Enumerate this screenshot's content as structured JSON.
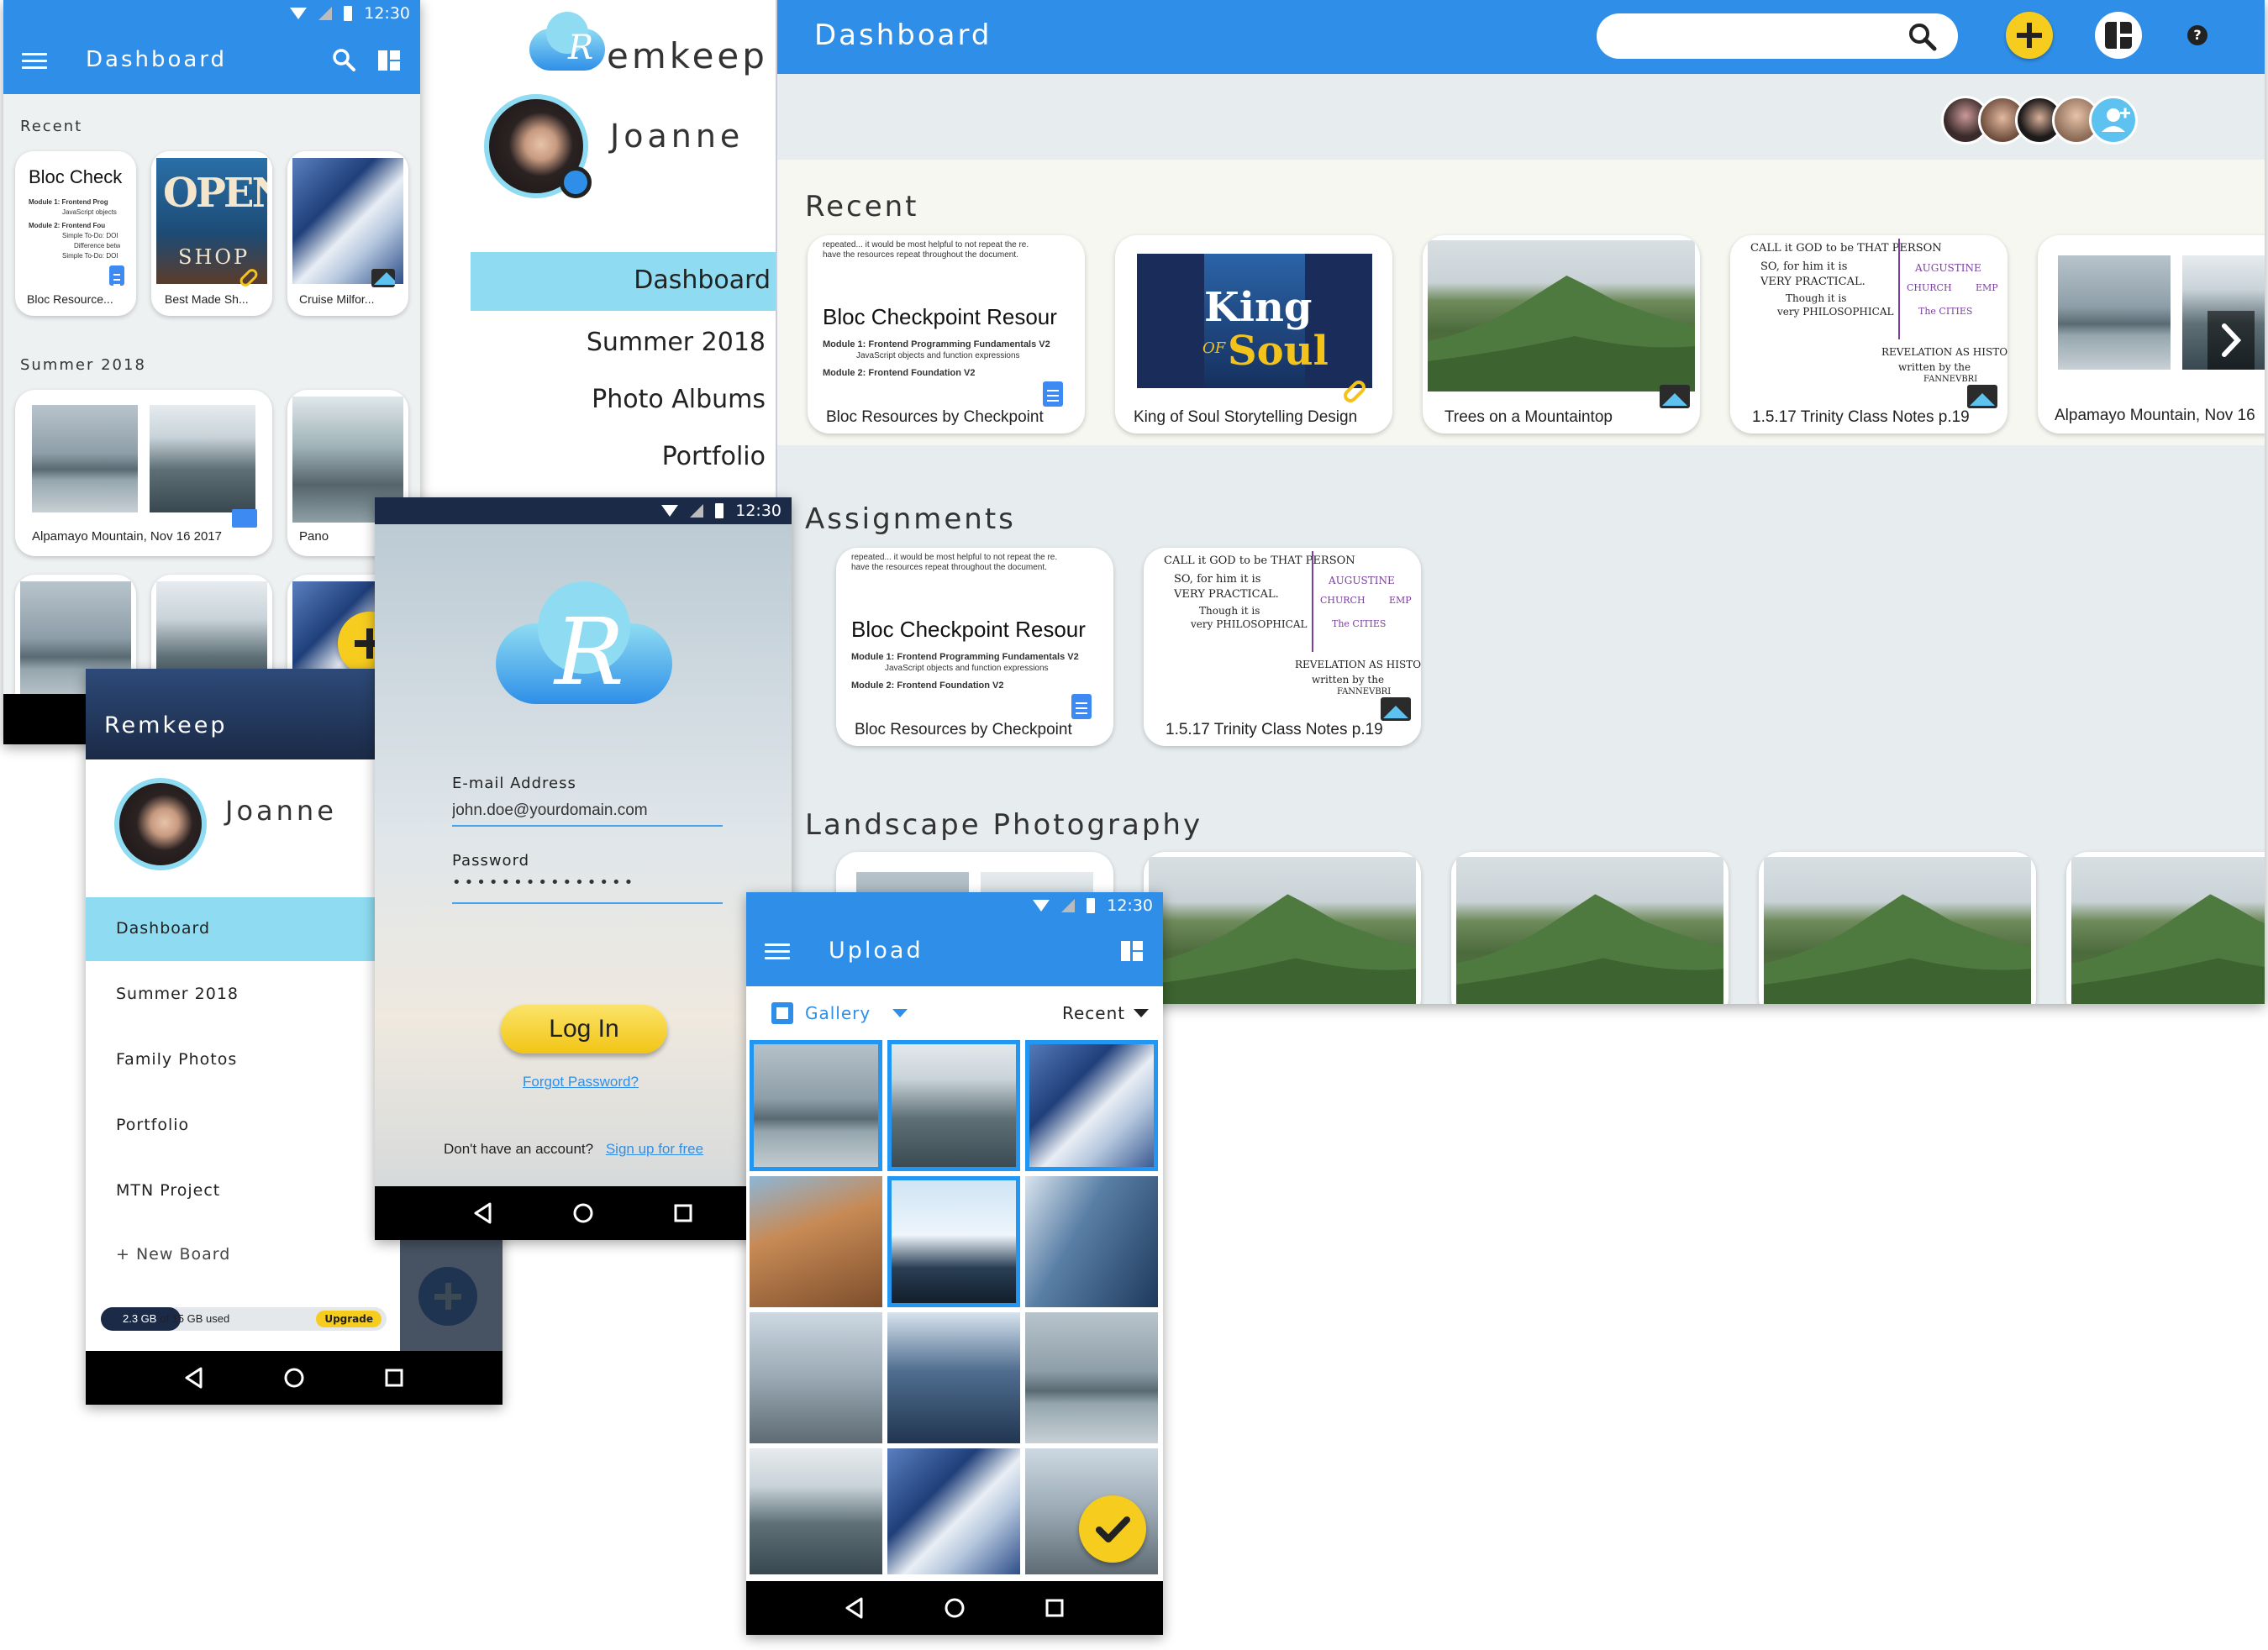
{
  "status_time": "12:30",
  "colors": {
    "primary": "#2f8fe8",
    "accent": "#f6cd1f",
    "highlight": "#8fdcf2",
    "dark": "#1b2a47"
  },
  "phone_dashboard": {
    "title": "Dashboard",
    "recent_heading": "Recent",
    "recent_cards": [
      {
        "doc_title": "Bloc Check",
        "lines": [
          "Module 1: Frontend Prog",
          "JavaScript objects",
          "Module 2: Frontend Fou",
          "Simple To-Do: DOI",
          "Difference betw",
          "Simple To-Do: DOI"
        ],
        "caption": "Bloc Resource..."
      },
      {
        "sign_top": "OPEN",
        "sign_bottom": "SHOP",
        "caption": "Best Made Sh..."
      },
      {
        "caption": "Cruise Milfor..."
      }
    ],
    "summer_heading": "Summer 2018",
    "summer_cards": [
      {
        "caption": "Alpamayo Mountain, Nov 16 2017"
      },
      {
        "caption": "Pano"
      }
    ]
  },
  "tablet_drawer": {
    "logo_text": "emkeep",
    "logo_letter": "R",
    "user_name": "Joanne",
    "items": [
      "Dashboard",
      "Summer 2018",
      "Photo Albums",
      "Portfolio"
    ]
  },
  "desktop": {
    "title": "Dashboard",
    "search": {
      "placeholder": ""
    },
    "sections": {
      "recent": "Recent",
      "assignments": "Assignments",
      "landscape": "Landscape Photography"
    },
    "recent_cards": [
      {
        "snippet1": "repeated... it would be most helpful to not repeat the re.",
        "snippet2": "have the resources repeat throughout the document.",
        "doc_title": "Bloc Checkpoint Resour",
        "m1": "Module 1: Frontend Programming Fundamentals V2",
        "m1sub": "JavaScript objects and function expressions",
        "m2": "Module 2: Frontend Foundation V2",
        "caption": "Bloc Resources by Checkpoint"
      },
      {
        "poster_big": "King",
        "poster_of": "OF",
        "poster_soul": "Soul",
        "caption": "King of Soul Storytelling Design"
      },
      {
        "caption": "Trees on a Mountaintop"
      },
      {
        "notes": [
          "CALL it GOD to be THAT PERSON",
          "SO, for him it is",
          "VERY PRACTICAL.",
          "Though it is",
          "very PHILOSOPHICAL",
          "AUGUSTINE",
          "CHURCH",
          "EMP",
          "The CITIES",
          "REVELATION AS HISTOR",
          "written by the",
          "FANNEVBRI"
        ],
        "caption": "1.5.17 Trinity Class Notes p.19"
      },
      {
        "caption": "Alpamayo Mountain, Nov 16"
      }
    ],
    "assignment_cards": [
      {
        "snippet1": "repeated... it would be most helpful to not repeat the re.",
        "snippet2": "have the resources repeat throughout the document.",
        "doc_title": "Bloc Checkpoint Resour",
        "m1": "Module 1: Frontend Programming Fundamentals V2",
        "m1sub": "JavaScript objects and function expressions",
        "m2": "Module 2: Frontend Foundation V2",
        "caption": "Bloc Resources by Checkpoint"
      },
      {
        "notes": [
          "CALL it GOD to be THAT PERSON",
          "SO, for him it is",
          "VERY PRACTICAL.",
          "Though it is",
          "very PHILOSOPHICAL",
          "AUGUSTINE",
          "CHURCH",
          "EMP",
          "The CITIES",
          "REVELATION AS HISTOR",
          "written by the",
          "FANNEVBRI"
        ],
        "caption": "1.5.17 Trinity Class Notes p.19"
      }
    ]
  },
  "phone_drawer": {
    "app_name": "Remkeep",
    "user_name": "Joanne",
    "items": [
      "Dashboard",
      "Summer 2018",
      "Family Photos",
      "Portfolio",
      "MTN Project",
      "+ New Board"
    ],
    "storage": {
      "used": "2.3 GB",
      "rest": "of 15 GB used",
      "upgrade": "Upgrade",
      "fraction": 0.153
    }
  },
  "login": {
    "logo_letter": "R",
    "email_label": "E-mail Address",
    "email_value": "john.doe@yourdomain.com",
    "password_label": "Password",
    "password_value": "•••••••••••••••",
    "login_button": "Log In",
    "forgot": "Forgot Password?",
    "no_account": "Don't have an account?",
    "signup": "Sign up for free"
  },
  "upload": {
    "title": "Upload",
    "source": "Gallery",
    "sort": "Recent"
  }
}
